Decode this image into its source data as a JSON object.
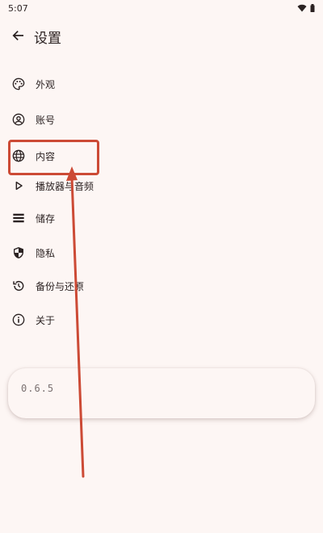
{
  "status_bar": {
    "time": "5:07"
  },
  "header": {
    "title": "设置"
  },
  "menu": [
    {
      "label": "外观",
      "icon": "palette-icon"
    },
    {
      "label": "账号",
      "icon": "account-circle-icon"
    },
    {
      "label": "内容",
      "icon": "globe-icon"
    },
    {
      "label": "播放器与音频",
      "icon": "play-arrow-icon"
    },
    {
      "label": "储存",
      "icon": "storage-list-icon"
    },
    {
      "label": "隐私",
      "icon": "shield-icon"
    },
    {
      "label": "备份与还原",
      "icon": "restore-icon"
    },
    {
      "label": "关于",
      "icon": "info-icon"
    }
  ],
  "version": "0.6.5",
  "colors": {
    "background": "#fdf6f4",
    "text": "#2b2222",
    "annotation": "#cc4a35"
  }
}
